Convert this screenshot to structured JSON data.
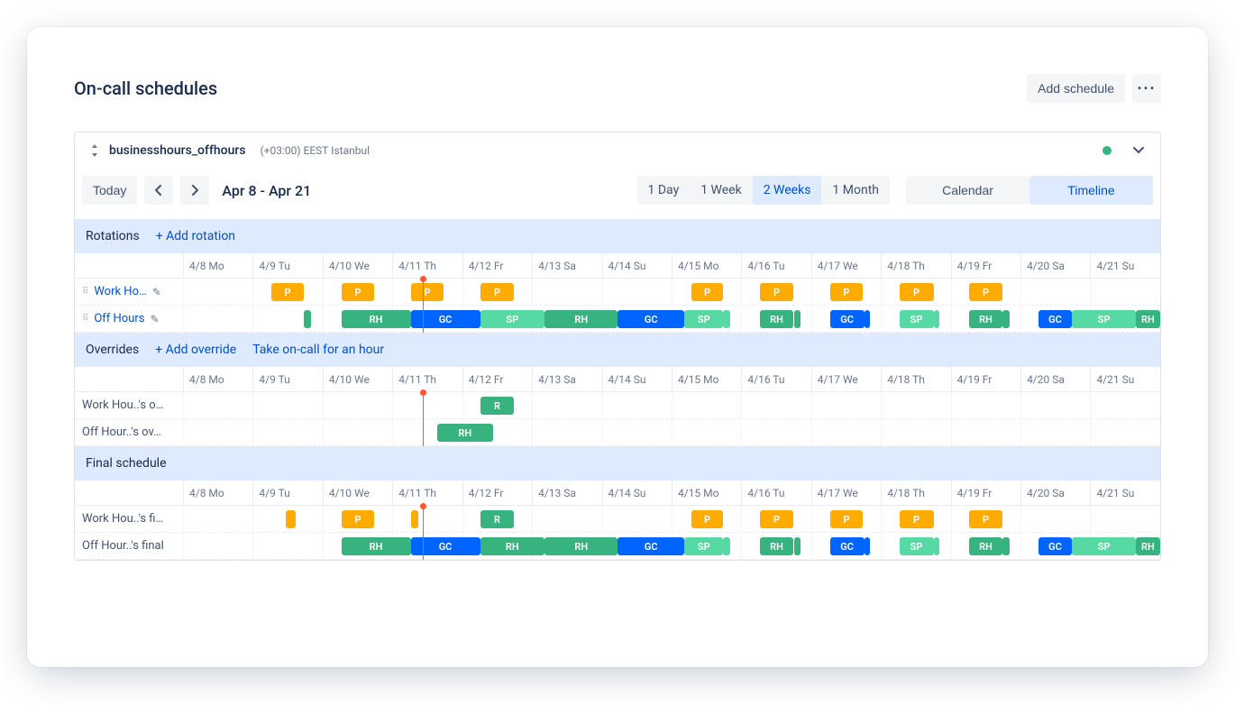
{
  "page": {
    "title": "On-call schedules",
    "addScheduleBtn": "Add schedule"
  },
  "toolbar": {
    "today": "Today",
    "range_label": "Apr 8 - Apr 21",
    "zoom": [
      "1 Day",
      "1 Week",
      "2 Weeks",
      "1 Month"
    ],
    "zoom_active": 2,
    "view": {
      "calendar": "Calendar",
      "timeline": "Timeline",
      "active": "timeline"
    }
  },
  "schedule": {
    "name": "businesshours_offhours",
    "tz": "(+03:00) EEST Istanbul",
    "status_color": "#36b37e"
  },
  "days": [
    "4/8 Mo",
    "4/9 Tu",
    "4/10 We",
    "4/11 Th",
    "4/12 Fr",
    "4/13 Sa",
    "4/14 Su",
    "4/15 Mo",
    "4/16 Tu",
    "4/17 We",
    "4/18 Th",
    "4/19 Fr",
    "4/20 Sa",
    "4/21 Su"
  ],
  "now_indicator_pct": 24.5,
  "sections": {
    "rotations": {
      "title": "Rotations",
      "add": "+ Add rotation",
      "rows": [
        {
          "id": "work-hours",
          "name": "Work Ho…",
          "editable": true,
          "bars": [
            {
              "s": 9,
              "e": 12.4,
              "lbl": "P",
              "c": "c-p"
            },
            {
              "s": 16.2,
              "e": 19.6,
              "lbl": "P",
              "c": "c-p"
            },
            {
              "s": 23.3,
              "e": 26.7,
              "lbl": "P",
              "c": "c-p"
            },
            {
              "s": 30.4,
              "e": 33.9,
              "lbl": "P",
              "c": "c-p"
            },
            {
              "s": 52,
              "e": 55.3,
              "lbl": "P",
              "c": "c-p"
            },
            {
              "s": 59,
              "e": 62.5,
              "lbl": "P",
              "c": "c-p"
            },
            {
              "s": 66.2,
              "e": 69.6,
              "lbl": "P",
              "c": "c-p"
            },
            {
              "s": 73.3,
              "e": 76.8,
              "lbl": "P",
              "c": "c-p"
            },
            {
              "s": 80.4,
              "e": 83.9,
              "lbl": "P",
              "c": "c-p"
            }
          ]
        },
        {
          "id": "off-hours",
          "name": "Off Hours",
          "editable": true,
          "bars": [
            {
              "s": 12.4,
              "e": 13.1,
              "lbl": "",
              "c": "c-rh"
            },
            {
              "s": 16.2,
              "e": 23.3,
              "lbl": "RH",
              "c": "c-rh"
            },
            {
              "s": 23.3,
              "e": 30.4,
              "lbl": "GC",
              "c": "c-gc"
            },
            {
              "s": 30.4,
              "e": 37,
              "lbl": "SP",
              "c": "c-sp"
            },
            {
              "s": 37,
              "e": 44.5,
              "lbl": "RH",
              "c": "c-rh"
            },
            {
              "s": 44.5,
              "e": 51.3,
              "lbl": "GC",
              "c": "c-gc"
            },
            {
              "s": 51.3,
              "e": 55.3,
              "lbl": "SP",
              "c": "c-sp"
            },
            {
              "s": 55.3,
              "e": 56,
              "lbl": "",
              "c": "c-sp"
            },
            {
              "s": 59,
              "e": 62.5,
              "lbl": "RH",
              "c": "c-rh"
            },
            {
              "s": 62.5,
              "e": 63.2,
              "lbl": "",
              "c": "c-rh"
            },
            {
              "s": 66.2,
              "e": 69.7,
              "lbl": "GC",
              "c": "c-gc"
            },
            {
              "s": 69.7,
              "e": 70.3,
              "lbl": "",
              "c": "c-gc"
            },
            {
              "s": 73.3,
              "e": 76.8,
              "lbl": "SP",
              "c": "c-sp"
            },
            {
              "s": 76.8,
              "e": 77.4,
              "lbl": "",
              "c": "c-sp"
            },
            {
              "s": 80.4,
              "e": 83.9,
              "lbl": "RH",
              "c": "c-rh"
            },
            {
              "s": 83.9,
              "e": 84.6,
              "lbl": "",
              "c": "c-rh"
            },
            {
              "s": 87.5,
              "e": 91,
              "lbl": "GC",
              "c": "c-gc"
            },
            {
              "s": 91,
              "e": 97.5,
              "lbl": "SP",
              "c": "c-sp"
            },
            {
              "s": 97.5,
              "e": 100,
              "lbl": "RH",
              "c": "c-rh"
            }
          ]
        }
      ]
    },
    "overrides": {
      "title": "Overrides",
      "add": "+ Add override",
      "take": "Take on-call for an hour",
      "rows": [
        {
          "id": "work-hours-overrides",
          "name": "Work Hou..'s o…",
          "bars": [
            {
              "s": 30.4,
              "e": 33.9,
              "lbl": "R",
              "c": "c-rh"
            }
          ]
        },
        {
          "id": "off-hours-overrides",
          "name": "Off Hour..'s ov…",
          "bars": [
            {
              "s": 26,
              "e": 31.7,
              "lbl": "RH",
              "c": "c-rh"
            }
          ]
        }
      ]
    },
    "final": {
      "title": "Final schedule",
      "rows": [
        {
          "id": "work-hours-final",
          "name": "Work Hou..'s fi…",
          "bars": [
            {
              "s": 10.5,
              "e": 11.5,
              "lbl": "",
              "c": "c-p"
            },
            {
              "s": 16.2,
              "e": 19.6,
              "lbl": "P",
              "c": "c-p"
            },
            {
              "s": 23.3,
              "e": 24.1,
              "lbl": "",
              "c": "c-p"
            },
            {
              "s": 30.4,
              "e": 33.9,
              "lbl": "R",
              "c": "c-rh"
            },
            {
              "s": 52,
              "e": 55.3,
              "lbl": "P",
              "c": "c-p"
            },
            {
              "s": 59,
              "e": 62.5,
              "lbl": "P",
              "c": "c-p"
            },
            {
              "s": 66.2,
              "e": 69.6,
              "lbl": "P",
              "c": "c-p"
            },
            {
              "s": 73.3,
              "e": 76.8,
              "lbl": "P",
              "c": "c-p"
            },
            {
              "s": 80.4,
              "e": 83.9,
              "lbl": "P",
              "c": "c-p"
            }
          ]
        },
        {
          "id": "off-hours-final",
          "name": "Off Hour..'s final",
          "bars": [
            {
              "s": 16.2,
              "e": 23.3,
              "lbl": "RH",
              "c": "c-rh"
            },
            {
              "s": 23.3,
              "e": 30.4,
              "lbl": "GC",
              "c": "c-gc"
            },
            {
              "s": 30.4,
              "e": 37,
              "lbl": "RH",
              "c": "c-rh"
            },
            {
              "s": 37,
              "e": 44.5,
              "lbl": "RH",
              "c": "c-rh"
            },
            {
              "s": 44.5,
              "e": 51.3,
              "lbl": "GC",
              "c": "c-gc"
            },
            {
              "s": 51.3,
              "e": 55.3,
              "lbl": "SP",
              "c": "c-sp"
            },
            {
              "s": 55.3,
              "e": 56,
              "lbl": "",
              "c": "c-sp"
            },
            {
              "s": 59,
              "e": 62.5,
              "lbl": "RH",
              "c": "c-rh"
            },
            {
              "s": 62.5,
              "e": 63.2,
              "lbl": "",
              "c": "c-rh"
            },
            {
              "s": 66.2,
              "e": 69.7,
              "lbl": "GC",
              "c": "c-gc"
            },
            {
              "s": 69.7,
              "e": 70.3,
              "lbl": "",
              "c": "c-gc"
            },
            {
              "s": 73.3,
              "e": 76.8,
              "lbl": "SP",
              "c": "c-sp"
            },
            {
              "s": 76.8,
              "e": 77.4,
              "lbl": "",
              "c": "c-sp"
            },
            {
              "s": 80.4,
              "e": 83.9,
              "lbl": "RH",
              "c": "c-rh"
            },
            {
              "s": 83.9,
              "e": 84.6,
              "lbl": "",
              "c": "c-rh"
            },
            {
              "s": 87.5,
              "e": 91,
              "lbl": "GC",
              "c": "c-gc"
            },
            {
              "s": 91,
              "e": 97.5,
              "lbl": "SP",
              "c": "c-sp"
            },
            {
              "s": 97.5,
              "e": 100,
              "lbl": "RH",
              "c": "c-rh"
            }
          ]
        }
      ]
    }
  }
}
